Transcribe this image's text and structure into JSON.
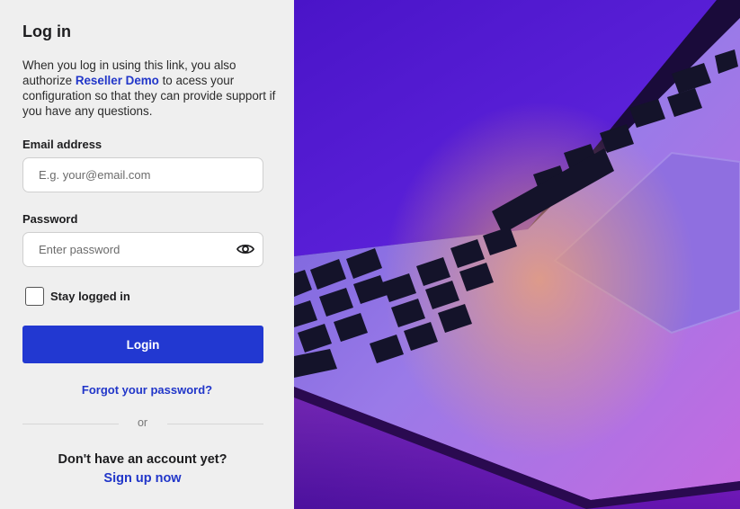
{
  "login": {
    "title": "Log in",
    "intro_before": "When you log in using this link, you also authorize ",
    "intro_brand": "Reseller Demo",
    "intro_after": " to acess your configuration so that they can provide support if you have any questions.",
    "email_label": "Email address",
    "email_placeholder": "E.g. your@email.com",
    "email_value": "",
    "password_label": "Password",
    "password_placeholder": "Enter password",
    "password_value": "",
    "password_toggle_icon": "eye-icon",
    "stay_logged_in_label": "Stay logged in",
    "stay_logged_in_checked": false,
    "login_button": "Login",
    "forgot_link": "Forgot your password?",
    "divider_text": "or",
    "no_account_text": "Don't have an account yet?",
    "signup_link": "Sign up now"
  },
  "colors": {
    "accent": "#2238d1",
    "link": "#2136c9",
    "panel_bg": "#efefef"
  },
  "hero_image": {
    "subject": "laptop keyboard under purple light"
  }
}
